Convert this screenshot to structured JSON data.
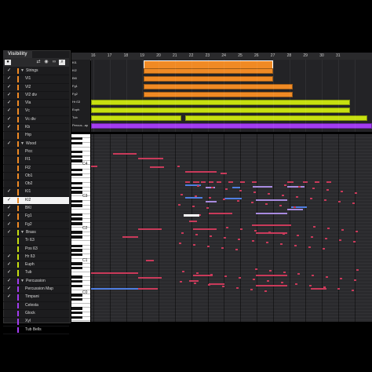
{
  "panel": {
    "tab_label": "Visibility",
    "toolbar": {
      "icons": [
        "record-icon",
        "arrows-icon",
        "eye-icon",
        "link-icon",
        "search-icon"
      ]
    },
    "tracks": [
      {
        "label": "Strings",
        "folder": true,
        "checked": true,
        "color": "#f08a24"
      },
      {
        "label": "Vl1",
        "folder": false,
        "checked": true,
        "color": "#f08a24"
      },
      {
        "label": "Vl2",
        "folder": false,
        "checked": true,
        "color": "#f08a24"
      },
      {
        "label": "Vl2 div",
        "folder": false,
        "checked": true,
        "color": "#f08a24"
      },
      {
        "label": "Vla",
        "folder": false,
        "checked": true,
        "color": "#f08a24"
      },
      {
        "label": "Vc",
        "folder": false,
        "checked": true,
        "color": "#f08a24"
      },
      {
        "label": "Vc div",
        "folder": false,
        "checked": true,
        "color": "#f08a24"
      },
      {
        "label": "Kb",
        "folder": false,
        "checked": true,
        "color": "#f08a24"
      },
      {
        "label": "Hrp",
        "folder": false,
        "checked": false,
        "color": "#f08a24"
      },
      {
        "label": "Wood",
        "folder": true,
        "checked": true,
        "color": "#f08a24"
      },
      {
        "label": "Picc",
        "folder": false,
        "checked": false,
        "color": "#f08a24"
      },
      {
        "label": "Fl1",
        "folder": false,
        "checked": false,
        "color": "#f08a24"
      },
      {
        "label": "Fl2",
        "folder": false,
        "checked": false,
        "color": "#f08a24"
      },
      {
        "label": "Ob1",
        "folder": false,
        "checked": false,
        "color": "#f08a24"
      },
      {
        "label": "Ob2",
        "folder": false,
        "checked": false,
        "color": "#f08a24"
      },
      {
        "label": "Kl1",
        "folder": false,
        "checked": true,
        "color": "#f08a24"
      },
      {
        "label": "Kl2",
        "folder": false,
        "checked": true,
        "color": "#f08a24",
        "selected": true
      },
      {
        "label": "BKl",
        "folder": false,
        "checked": true,
        "color": "#f08a24"
      },
      {
        "label": "Fg1",
        "folder": false,
        "checked": true,
        "color": "#f08a24"
      },
      {
        "label": "Fg2",
        "folder": false,
        "checked": true,
        "color": "#f08a24"
      },
      {
        "label": "Brass",
        "folder": true,
        "checked": true,
        "color": "#c7e010"
      },
      {
        "label": "Tr ß3",
        "folder": false,
        "checked": false,
        "color": "#c7e010"
      },
      {
        "label": "Pos ß3",
        "folder": false,
        "checked": false,
        "color": "#c7e010"
      },
      {
        "label": "Hr ß3",
        "folder": false,
        "checked": true,
        "color": "#c7e010"
      },
      {
        "label": "Euph",
        "folder": false,
        "checked": true,
        "color": "#c7e010"
      },
      {
        "label": "Tub",
        "folder": false,
        "checked": true,
        "color": "#c7e010"
      },
      {
        "label": "Percussion",
        "folder": true,
        "checked": true,
        "color": "#a23cf0"
      },
      {
        "label": "Percussion Map",
        "folder": false,
        "checked": true,
        "color": "#a23cf0"
      },
      {
        "label": "Timpani",
        "folder": false,
        "checked": true,
        "color": "#a23cf0"
      },
      {
        "label": "Celesta",
        "folder": false,
        "checked": false,
        "color": "#a23cf0"
      },
      {
        "label": "Glock",
        "folder": false,
        "checked": false,
        "color": "#a23cf0"
      },
      {
        "label": "Xyl",
        "folder": false,
        "checked": false,
        "color": "#a23cf0"
      },
      {
        "label": "Tub Bells",
        "folder": false,
        "checked": false,
        "color": "#a23cf0"
      }
    ]
  },
  "ruler": {
    "bars": [
      "16",
      "17",
      "18",
      "19",
      "20",
      "21",
      "22",
      "23",
      "24",
      "25",
      "26",
      "27",
      "28",
      "29",
      "30",
      "31"
    ]
  },
  "arranger": {
    "lanes": [
      {
        "label": "Kl1",
        "color": "#f08a24"
      },
      {
        "label": "Kl2",
        "color": "#f08a24"
      },
      {
        "label": "BKl",
        "color": "#f08a24"
      },
      {
        "label": "Fg1",
        "color": "#f08a24"
      },
      {
        "label": "Fg2",
        "color": "#f08a24"
      },
      {
        "label": "Hr ß3",
        "color": "#c7e010"
      },
      {
        "label": "Euph",
        "color": "#c7e010"
      },
      {
        "label": "Tub",
        "color": "#c7e010"
      },
      {
        "label": "Percus...ap",
        "color": "#a23cf0"
      }
    ]
  },
  "piano_roll": {
    "octave_labels": [
      "C4",
      "C3",
      "C2",
      "C1",
      "C0"
    ]
  },
  "colors": {
    "orange": "#f08a24",
    "lime": "#c7e010",
    "purple": "#a23cf0",
    "note_red": "#c93a5a",
    "note_blue": "#4f7ee0",
    "note_lavender": "#a88be0"
  }
}
